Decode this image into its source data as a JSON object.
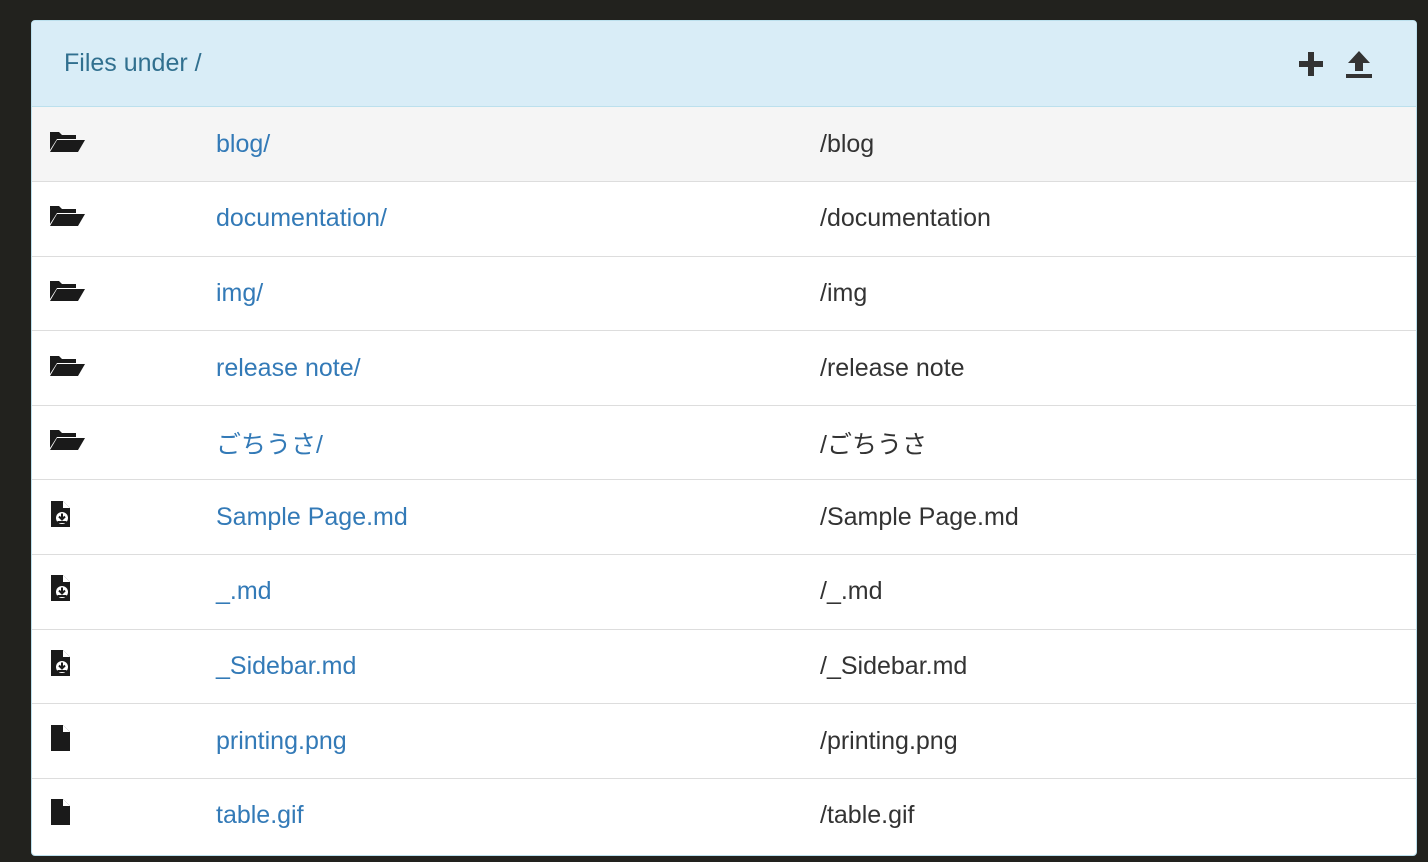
{
  "panel": {
    "title": "Files under /",
    "actions": [
      {
        "name": "add",
        "icon": "plus-icon"
      },
      {
        "name": "upload",
        "icon": "upload-icon"
      }
    ]
  },
  "colors": {
    "heading_bg": "#d9edf7",
    "heading_text": "#31708f",
    "link": "#337ab7",
    "text": "#333333"
  },
  "files": [
    {
      "icon": "folder-open-icon",
      "name": "blog/",
      "path": "/blog"
    },
    {
      "icon": "folder-open-icon",
      "name": "documentation/",
      "path": "/documentation"
    },
    {
      "icon": "folder-open-icon",
      "name": "img/",
      "path": "/img"
    },
    {
      "icon": "folder-open-icon",
      "name": "release note/",
      "path": "/release note"
    },
    {
      "icon": "folder-open-icon",
      "name": "ごちうさ/",
      "path": "/ごちうさ"
    },
    {
      "icon": "file-download-icon",
      "name": "Sample Page.md",
      "path": "/Sample Page.md"
    },
    {
      "icon": "file-download-icon",
      "name": "_.md",
      "path": "/_.md"
    },
    {
      "icon": "file-download-icon",
      "name": "_Sidebar.md",
      "path": "/_Sidebar.md"
    },
    {
      "icon": "file-icon",
      "name": "printing.png",
      "path": "/printing.png"
    },
    {
      "icon": "file-icon",
      "name": "table.gif",
      "path": "/table.gif"
    }
  ]
}
